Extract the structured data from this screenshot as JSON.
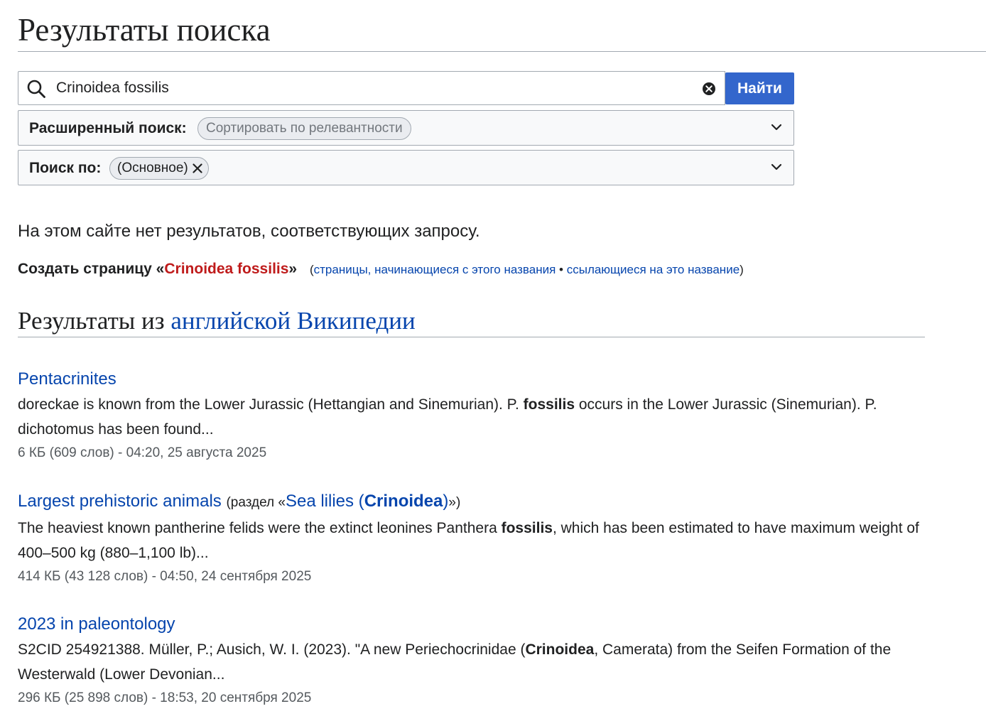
{
  "page": {
    "title": "Результаты поиска"
  },
  "search": {
    "query": "Crinoidea fossilis",
    "button_label": "Найти"
  },
  "advanced": {
    "label": "Расширенный поиск:",
    "sort_chip": "Сортировать по релевантности"
  },
  "namespaces": {
    "label": "Поиск по:",
    "chip": "(Основное)"
  },
  "no_results": "На этом сайте нет результатов, соответствующих запросу.",
  "create": {
    "prefix": "Создать страницу «",
    "title": "Crinoidea fossilis",
    "suffix": "»",
    "open_paren": "(",
    "prefix_link": "страницы, начинающиеся с этого названия",
    "separator": " • ",
    "links_link": "ссылающиеся на это название",
    "close_paren": ")"
  },
  "interwiki": {
    "heading_prefix": "Результаты из ",
    "heading_link": "английской Википедии"
  },
  "results": [
    {
      "title": "Pentacrinites",
      "snippet_parts": [
        "doreckae is known from the Lower Jurassic (Hettangian and Sinemurian). P. ",
        "fossilis",
        " occurs in the Lower Jurassic (Sinemurian). P. dichotomus has been found..."
      ],
      "meta": "6 КБ (609 слов) - 04:20, 25 августа 2025"
    },
    {
      "title": "Largest prehistoric animals",
      "section_prefix": "(раздел «",
      "section_link_before": "Sea lilies (",
      "section_link_bold": "Crinoidea",
      "section_link_after": ")",
      "section_suffix": "»)",
      "snippet_parts": [
        "The heaviest known pantherine felids were the extinct leonines Panthera ",
        "fossilis",
        ", which has been estimated to have maximum weight of 400–500 kg (880–1,100 lb)..."
      ],
      "meta": "414 КБ (43 128 слов) - 04:50, 24 сентября 2025"
    },
    {
      "title": "2023 in paleontology",
      "snippet_parts": [
        "S2CID 254921388. Müller, P.; Ausich, W. I. (2023). \"A new Periechocrinidae (",
        "Crinoidea",
        ", Camerata) from the Seifen Formation of the Westerwald (Lower Devonian..."
      ],
      "meta": "296 КБ (25 898 слов) - 18:53, 20 сентября 2025"
    }
  ],
  "icons": {
    "search": "search-icon",
    "clear": "clear-icon",
    "chevron": "chevron-down-icon",
    "remove": "close-icon"
  },
  "colors": {
    "accent": "#3366cc",
    "link": "#0645ad",
    "redlink": "#bf1b1b",
    "meta": "#54595d",
    "border": "#a2a9b1"
  }
}
